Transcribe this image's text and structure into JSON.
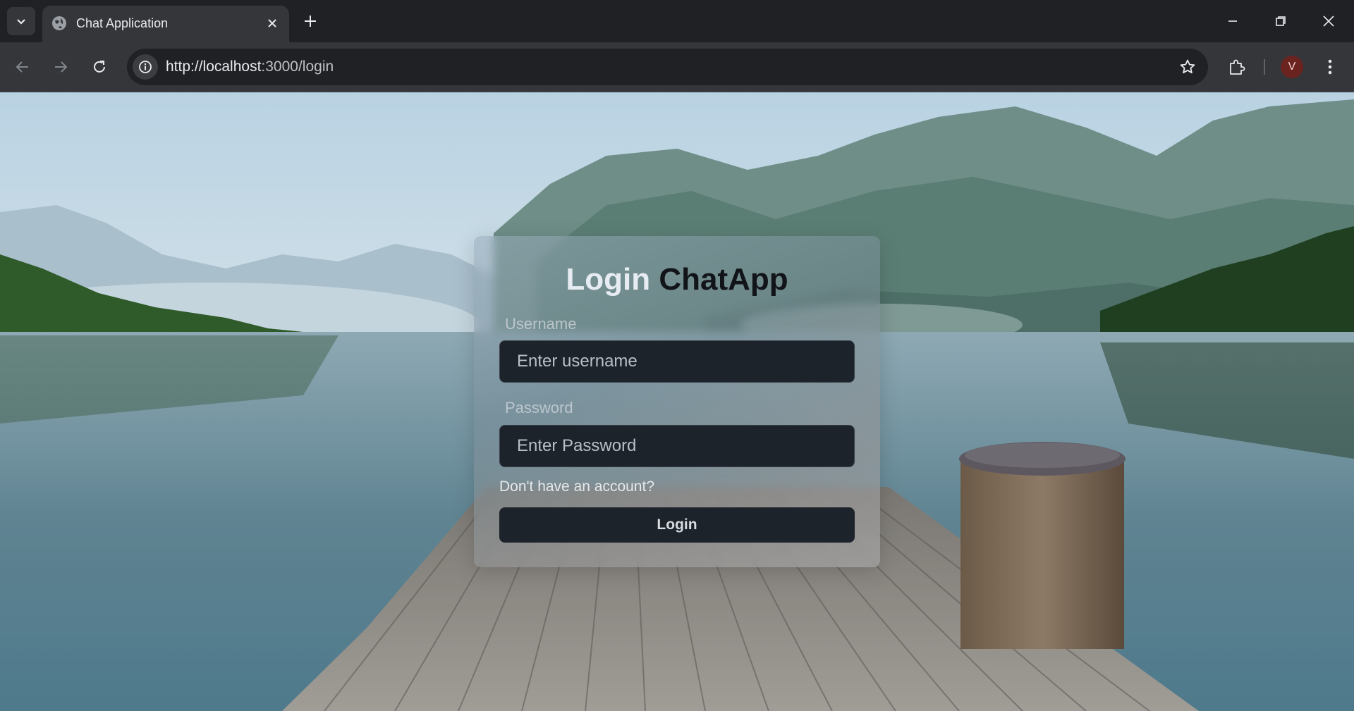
{
  "browser": {
    "tab_title": "Chat Application",
    "url_host": "http://localhost",
    "url_rest": ":3000/login",
    "avatar_letter": "V",
    "icons": [
      "tab-search-icon",
      "globe-icon",
      "close-icon",
      "plus-icon",
      "minimize-icon",
      "restore-icon",
      "window-close-icon",
      "back-icon",
      "forward-icon",
      "reload-icon",
      "info-icon",
      "star-icon",
      "extensions-icon",
      "kebab-menu-icon"
    ]
  },
  "login": {
    "title_part1": "Login",
    "title_part2": "ChatApp",
    "username_label": "Username",
    "username_placeholder": "Enter username",
    "password_label": "Password",
    "password_placeholder": "Enter Password",
    "signup_link": "Don't have an account?",
    "login_button": "Login"
  },
  "colors": {
    "chrome_dark": "#202124",
    "chrome_toolbar": "#35363a",
    "input_bg": "#1d232b",
    "avatar_bg": "#6b2320"
  }
}
